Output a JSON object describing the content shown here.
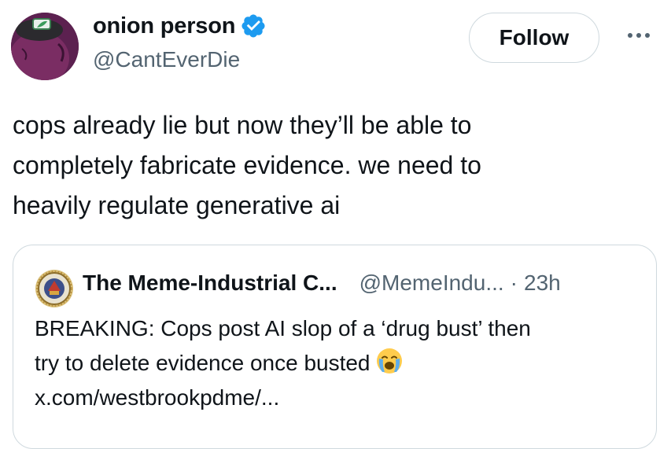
{
  "author": {
    "display_name": "onion person",
    "handle": "@CantEverDie",
    "verified": true,
    "avatar_icon": "onion-character-avatar"
  },
  "actions": {
    "follow_label": "Follow",
    "more_icon": "more-horizontal-icon"
  },
  "tweet": {
    "text": "cops already lie but now they’ll be able to\ncompletely fabricate evidence.  we need to\nheavily regulate generative ai"
  },
  "quote": {
    "display_name": "The Meme-Industrial C...",
    "handle": "@MemeIndu...",
    "separator": "·",
    "time": "23h",
    "avatar_icon": "seal-emblem-icon",
    "lines": [
      "BREAKING: Cops post AI slop of a ‘drug bust’ then",
      "try to delete evidence once busted",
      "x.com/westbrookpdme/..."
    ],
    "emoji": "loudly-crying-face-emoji"
  },
  "colors": {
    "text": "#0f1419",
    "secondary": "#536471",
    "border": "#cfd9de",
    "verified": "#1d9bf0"
  }
}
